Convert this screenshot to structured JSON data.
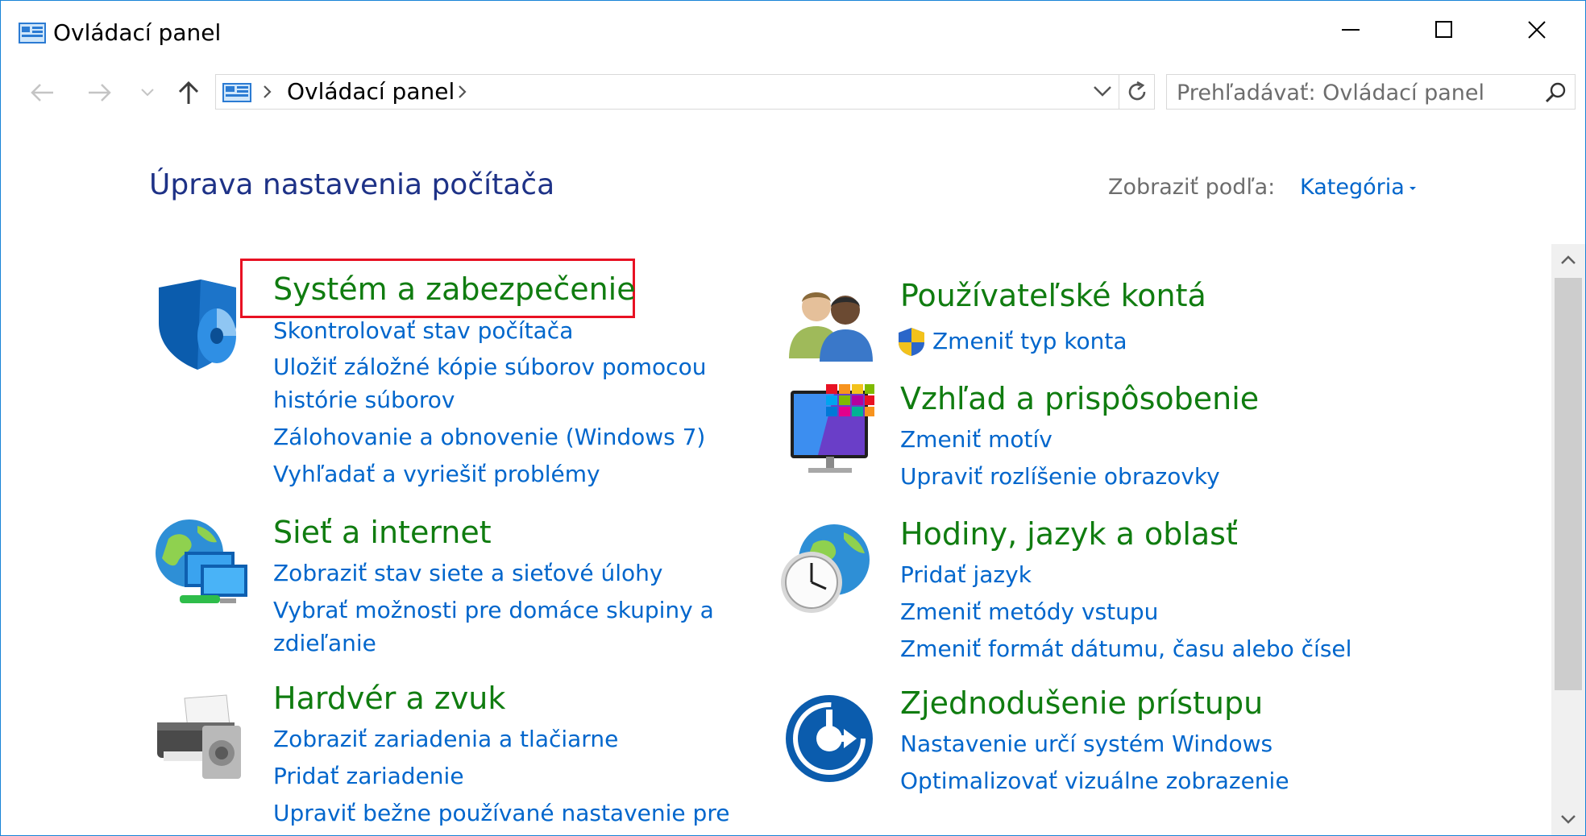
{
  "window": {
    "title": "Ovládací panel"
  },
  "address": {
    "path": "Ovládací panel"
  },
  "search": {
    "placeholder": "Prehľadávať: Ovládací panel"
  },
  "content": {
    "page_title": "Úprava nastavenia počítača",
    "view_by_label": "Zobraziť podľa:",
    "view_by_value": "Kategória"
  },
  "categories": {
    "system": {
      "title": "Systém a zabezpečenie",
      "links": [
        "Skontrolovať stav počítača",
        "Uložiť záložné kópie súborov pomocou",
        "histórie súborov",
        "Zálohovanie a obnovenie (Windows 7)",
        "Vyhľadať a vyriešiť problémy"
      ]
    },
    "network": {
      "title": "Sieť a internet",
      "links": [
        "Zobraziť stav siete a sieťové úlohy",
        "Vybrať možnosti pre domáce skupiny a",
        "zdieľanie"
      ]
    },
    "hardware": {
      "title": "Hardvér a zvuk",
      "links": [
        "Zobraziť zariadenia a tlačiarne",
        "Pridať zariadenie",
        "Upraviť bežne používané nastavenie pre"
      ]
    },
    "users": {
      "title": "Používateľské kontá",
      "links": [
        "Zmeniť typ konta"
      ]
    },
    "appearance": {
      "title": "Vzhľad a prispôsobenie",
      "links": [
        "Zmeniť motív",
        "Upraviť rozlíšenie obrazovky"
      ]
    },
    "clock": {
      "title": "Hodiny, jazyk a oblasť",
      "links": [
        "Pridať jazyk",
        "Zmeniť metódy vstupu",
        "Zmeniť formát dátumu, času alebo čísel"
      ]
    },
    "ease": {
      "title": "Zjednodušenie prístupu",
      "links": [
        "Nastavenie určí systém Windows",
        "Optimalizovať vizuálne zobrazenie"
      ]
    }
  },
  "icons": {
    "app": "control-panel-icon",
    "back": "back-arrow-icon",
    "forward": "forward-arrow-icon",
    "recent": "chevron-down-icon",
    "up": "up-arrow-icon",
    "refresh": "refresh-icon",
    "search": "search-icon",
    "minimize": "minimize-icon",
    "maximize": "maximize-icon",
    "close": "close-icon"
  },
  "colors": {
    "category_title": "#107c10",
    "link": "#0066cc",
    "page_title": "#1e3287",
    "highlight": "#e81123",
    "window_border": "#1883d7"
  }
}
